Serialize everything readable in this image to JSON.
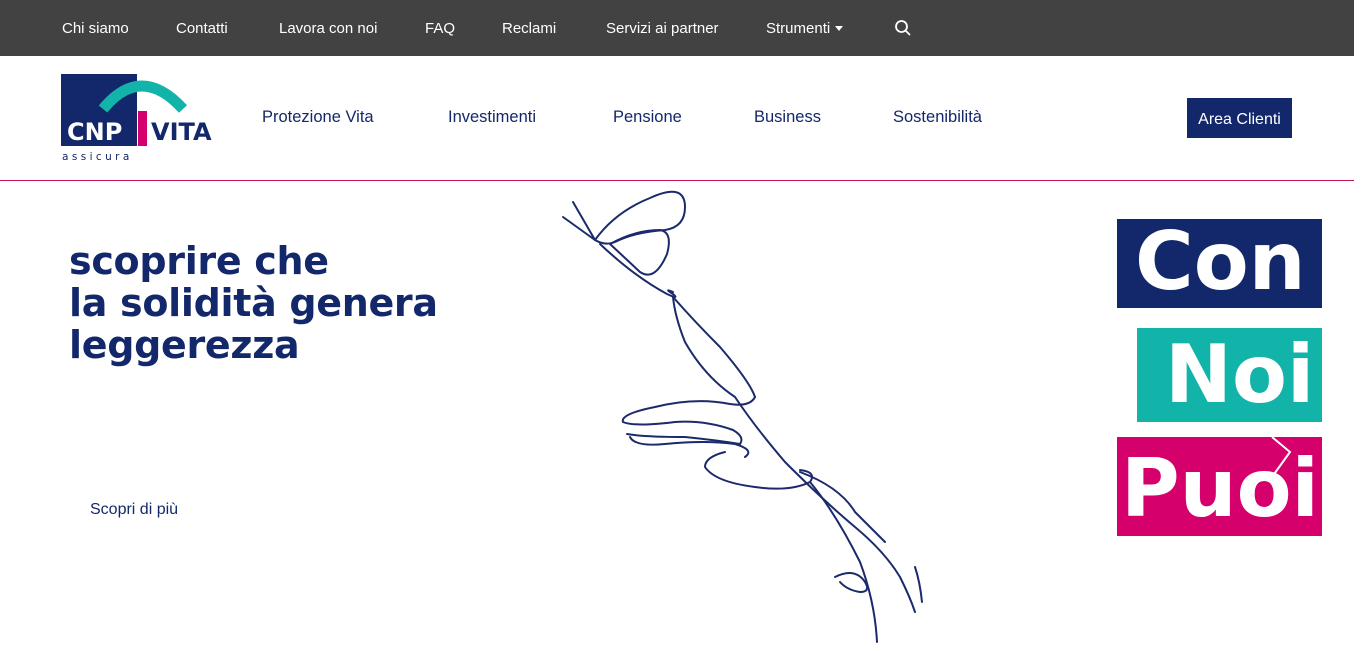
{
  "topbar": {
    "links": [
      {
        "label": "Chi siamo"
      },
      {
        "label": "Contatti"
      },
      {
        "label": "Lavora con noi"
      },
      {
        "label": "FAQ"
      },
      {
        "label": "Reclami"
      },
      {
        "label": "Servizi ai partner"
      },
      {
        "label": "Strumenti"
      }
    ],
    "search_icon": "search-icon",
    "dropdown_icon": "caret-down-icon"
  },
  "header": {
    "logo": {
      "brand_left": "CNP",
      "brand_right": "VITA",
      "tagline": "assicura"
    },
    "nav": [
      {
        "label": "Protezione Vita"
      },
      {
        "label": "Investimenti"
      },
      {
        "label": "Pensione"
      },
      {
        "label": "Business"
      },
      {
        "label": "Sostenibilità"
      }
    ],
    "cta_label": "Area Clienti"
  },
  "hero": {
    "title_lines": [
      "scoprire che",
      "la solidità genera",
      "leggerezza"
    ],
    "link_label": "Scopri di più",
    "badges": [
      {
        "text": "Con",
        "color": "#13286b"
      },
      {
        "text": "Noi",
        "color": "#12b3a9"
      },
      {
        "text": "Puoi",
        "color": "#d6006d"
      }
    ]
  },
  "colors": {
    "topbar_bg": "#424242",
    "brand_navy": "#13286b",
    "brand_teal": "#12b3a9",
    "brand_magenta": "#d6006d"
  }
}
